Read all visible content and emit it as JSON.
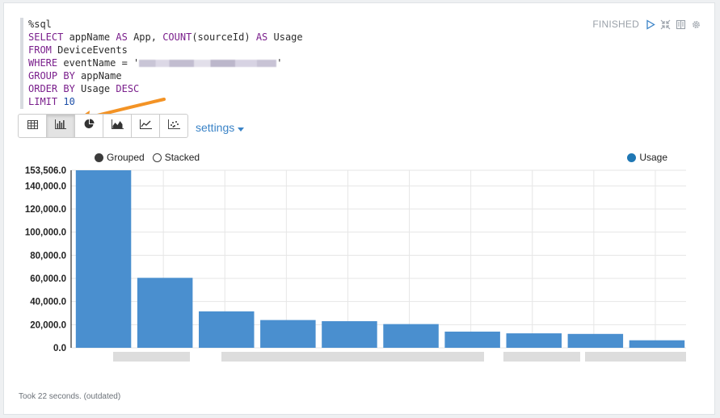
{
  "paragraph": {
    "code_lines": [
      {
        "parts": [
          {
            "t": "%sql",
            "k": "plain"
          }
        ]
      },
      {
        "parts": [
          {
            "t": "SELECT",
            "k": "kw"
          },
          {
            "t": " appName ",
            "k": "plain"
          },
          {
            "t": "AS",
            "k": "kw"
          },
          {
            "t": " App, ",
            "k": "plain"
          },
          {
            "t": "COUNT",
            "k": "kw"
          },
          {
            "t": "(sourceId) ",
            "k": "plain"
          },
          {
            "t": "AS",
            "k": "kw"
          },
          {
            "t": " Usage",
            "k": "plain"
          }
        ]
      },
      {
        "parts": [
          {
            "t": "FROM",
            "k": "kw"
          },
          {
            "t": " DeviceEvents",
            "k": "plain"
          }
        ]
      },
      {
        "parts": [
          {
            "t": "WHERE",
            "k": "kw"
          },
          {
            "t": " eventName = '",
            "k": "plain"
          },
          {
            "t": "",
            "k": "redacted"
          },
          {
            "t": "'",
            "k": "plain"
          }
        ]
      },
      {
        "parts": [
          {
            "t": "GROUP BY",
            "k": "kw"
          },
          {
            "t": " appName",
            "k": "plain"
          }
        ]
      },
      {
        "parts": [
          {
            "t": "ORDER BY",
            "k": "kw"
          },
          {
            "t": " Usage ",
            "k": "plain"
          },
          {
            "t": "DESC",
            "k": "kw"
          }
        ]
      },
      {
        "parts": [
          {
            "t": "LIMIT",
            "k": "kw"
          },
          {
            "t": " ",
            "k": "plain"
          },
          {
            "t": "10",
            "k": "num"
          }
        ]
      }
    ],
    "status": "FINISHED",
    "status_icons": [
      "run-icon",
      "collapse-icon",
      "book-icon",
      "gear-icon"
    ],
    "settings_label": "settings",
    "footer": "Took 22 seconds. (outdated)"
  },
  "toolbar": {
    "buttons": [
      "table-icon",
      "bar-chart-icon",
      "pie-chart-icon",
      "area-chart-icon",
      "line-chart-icon",
      "scatter-chart-icon"
    ],
    "active": "bar-chart-icon"
  },
  "legend": {
    "grouped": "Grouped",
    "stacked": "Stacked",
    "mode_selected": "Grouped",
    "series_label": "Usage"
  },
  "colors": {
    "bar": "#4a8fcf",
    "accent_arrow": "#f39325",
    "link": "#3a83c7"
  },
  "chart_data": {
    "type": "bar",
    "categories": [
      "",
      "",
      "",
      "",
      "",
      "",
      "",
      "",
      "",
      ""
    ],
    "series": [
      {
        "name": "Usage",
        "values": [
          153506,
          60500,
          31500,
          24000,
          23000,
          20500,
          14000,
          12500,
          12000,
          6500
        ]
      }
    ],
    "ylim": [
      0,
      153506
    ],
    "yticks": [
      0,
      20000,
      40000,
      60000,
      80000,
      100000,
      120000,
      140000,
      153506
    ],
    "ytick_labels": [
      "0.0",
      "20,000.0",
      "40,000.0",
      "60,000.0",
      "80,000.0",
      "100,000.0",
      "120,000.0",
      "140,000.0",
      "153,506.0"
    ],
    "grid": true,
    "x_labels_redacted": true
  }
}
